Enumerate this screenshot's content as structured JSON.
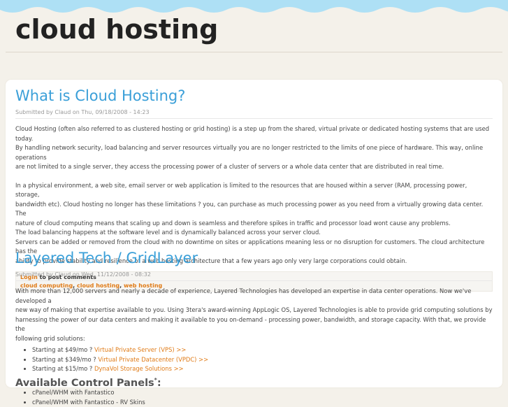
{
  "site": {
    "title": "cloud hosting"
  },
  "colors": {
    "accent": "#3a9fd8",
    "link": "#e07b17",
    "sky": "#aee0f5",
    "background": "#f4f1ea"
  },
  "node1": {
    "title": "What is Cloud Hosting?",
    "submitted": "Submitted by Claud on Thu, 09/18/2008 - 14:23",
    "lines": [
      "Cloud Hosting (often also referred to as clustered hosting or grid hosting) is a step up from the shared, virtual private or dedicated hosting systems that are used today.",
      "By handling network security, load balancing and server resources virtually you are no longer restricted to the limits of one piece of hardware. This way, online operations",
      "are not limited to a single server, they access the processing power of a cluster of servers or a whole data center that are distributed in real time.",
      "",
      "In a physical environment, a web site, email server or web application is limited to the resources that are housed within a server (RAM, processing power, storage,",
      "bandwidth etc). Cloud hosting no longer has these limitations ? you, can purchase as much processing power as you need from a virtually growing data center. The",
      "nature of cloud computing means that scaling up and down is seamless and therefore spikes in traffic and processor load wont cause any problems.",
      "The load balancing happens at the software level and is dynamically balanced across your server cloud.",
      "Servers can be added or removed from the cloud with no downtime on sites or applications meaning less or no disruption for customers. The cloud architecture has the",
      "ability to provide stability and resilience of a web hosting architecture that a few years ago only very large corporations could obtain."
    ],
    "login_label": "Login",
    "login_suffix": " to post comments",
    "tags": [
      "cloud computing",
      "cloud hosting",
      "web hosting"
    ]
  },
  "node2": {
    "title": "Layered Tech / GridLayer",
    "submitted": "Submitted by Claud on Wed, 11/12/2008 - 08:32",
    "lines": [
      "With more than 12,000 servers and nearly a decade of experience, Layered Technologies has developed an expertise in data center operations. Now we've developed a",
      "new way of making that expertise available to you. Using 3tera's award-winning AppLogic OS, Layered Technologies is able to provide grid computing solutions by",
      "harnessing the power of our data centers and making it available to you on-demand - processing power, bandwidth, and storage capacity. With that, we provide the",
      "following grid solutions:"
    ],
    "offers": [
      {
        "prefix": "Starting at $49/mo ? ",
        "link": "Virtual Private Server (VPS) >>"
      },
      {
        "prefix": "Starting at $349/mo ? ",
        "link": "Virtual Private Datacenter (VPDC) >>"
      },
      {
        "prefix": "Starting at $15/mo ? ",
        "link": "DynaVol Storage Solutions >>"
      }
    ],
    "panels_heading": "Available Control Panels",
    "panels_heading_mark": "*",
    "panels_heading_colon": ":",
    "panels": [
      "cPanel/WHM with Fantastico",
      "cPanel/WHM with Fantastico - RV Skins"
    ]
  }
}
